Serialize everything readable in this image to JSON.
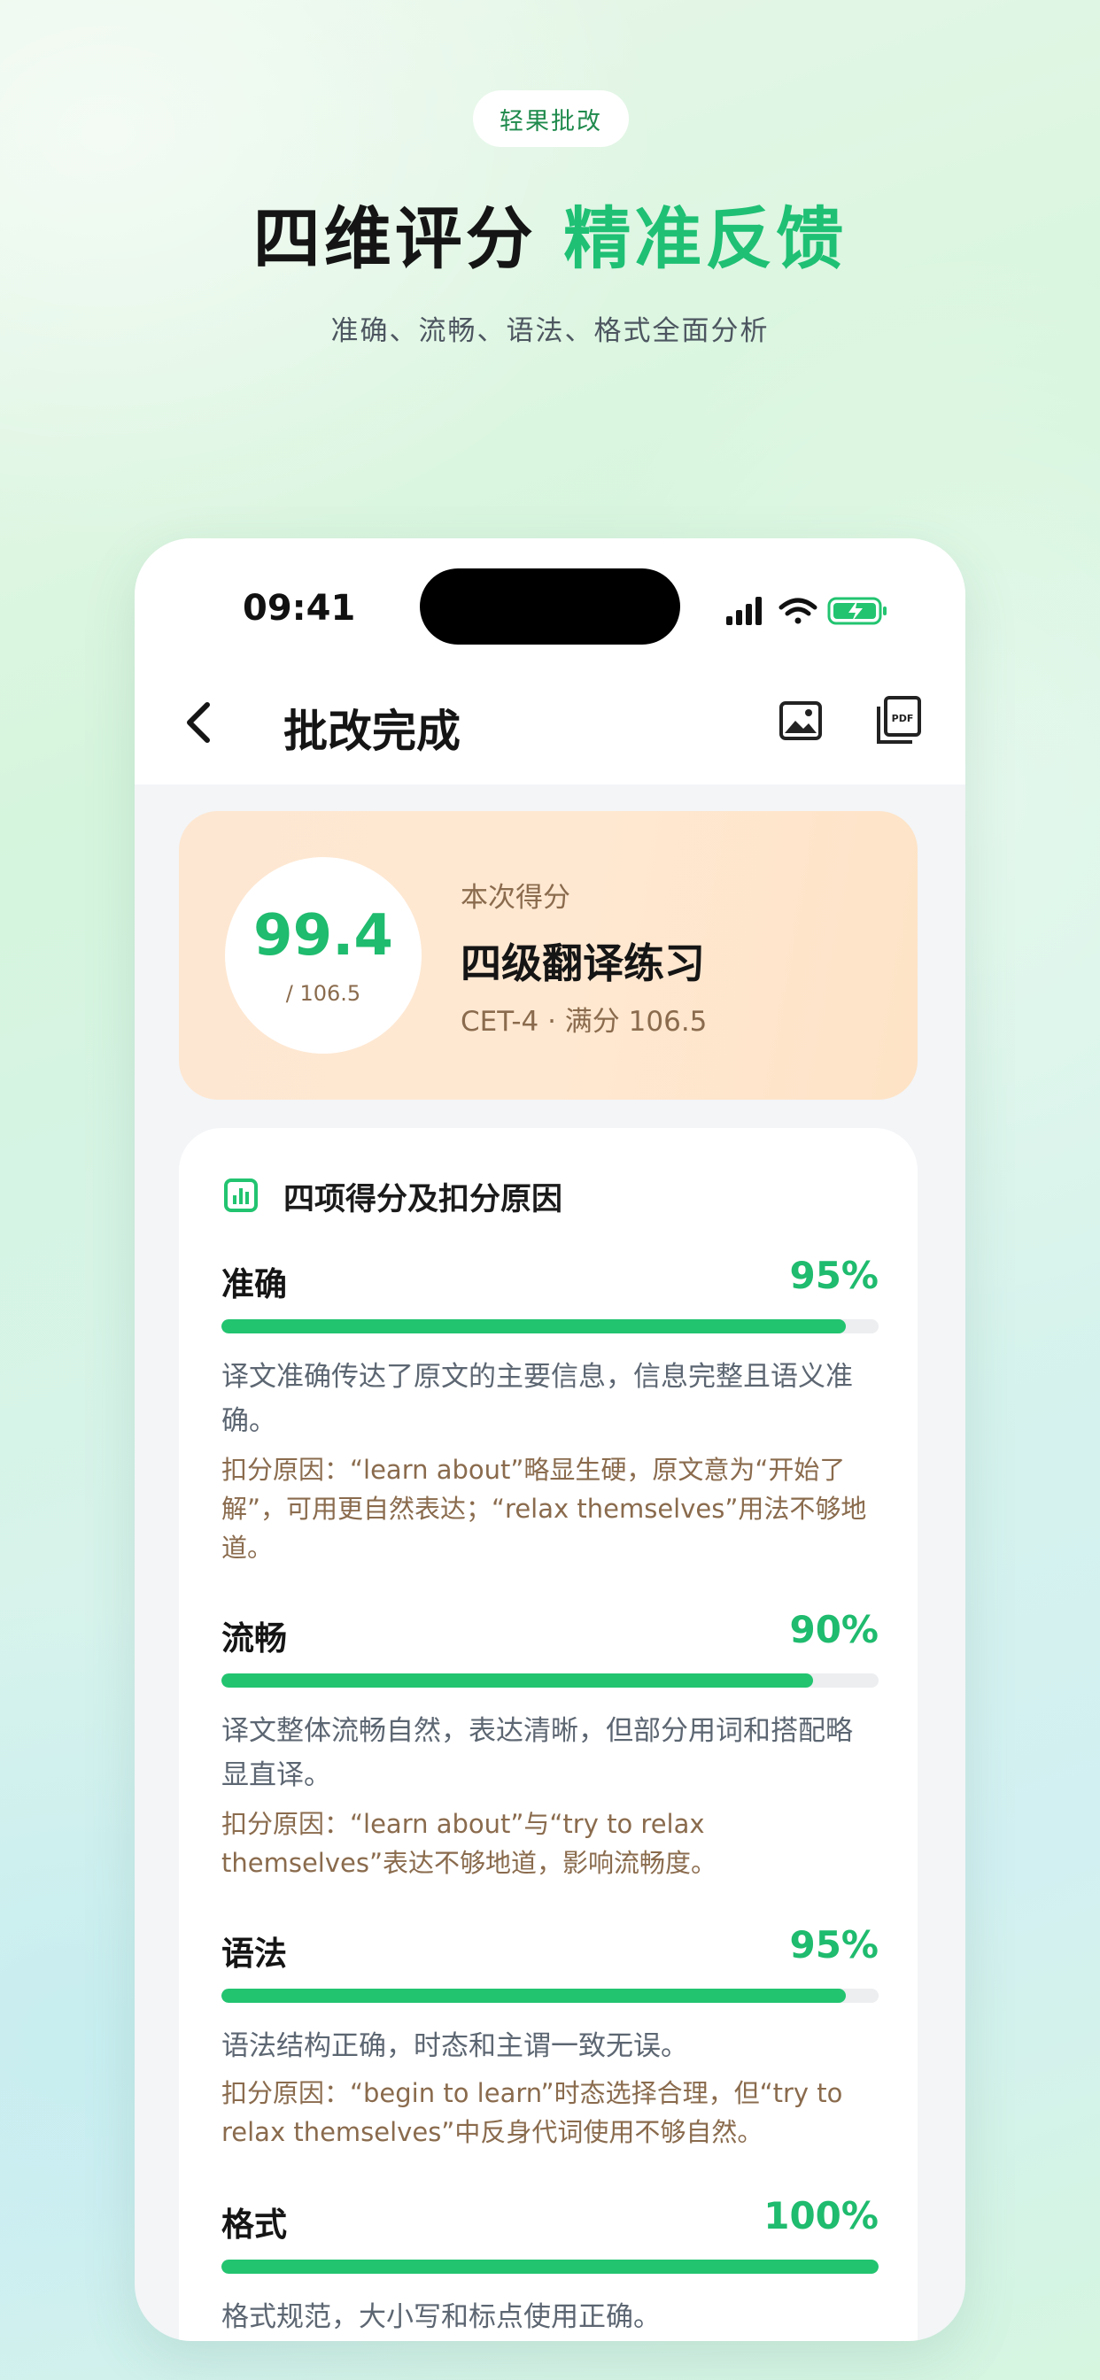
{
  "promo": {
    "badge": "轻果批改",
    "headline_main": "四维评分",
    "headline_accent": "精准反馈",
    "subline": "准确、流畅、语法、格式全面分析"
  },
  "status_bar": {
    "time": "09:41"
  },
  "nav": {
    "title": "批改完成",
    "image_icon": "image-icon",
    "pdf_icon": "pdf-icon"
  },
  "score_card": {
    "score": "99.4",
    "total": "/ 106.5",
    "label": "本次得分",
    "title": "四级翻译练习",
    "meta": "CET-4 · 满分 106.5"
  },
  "details": {
    "title": "四项得分及扣分原因",
    "metrics": [
      {
        "name": "准确",
        "percent_label": "95%",
        "percent": 95,
        "desc": "译文准确传达了原文的主要信息，信息完整且语义准确。",
        "reason": "扣分原因：“learn about”略显生硬，原文意为“开始了解”，可用更自然表达；“relax themselves”用法不够地道。"
      },
      {
        "name": "流畅",
        "percent_label": "90%",
        "percent": 90,
        "desc": "译文整体流畅自然，表达清晰，但部分用词和搭配略显直译。",
        "reason": "扣分原因：“learn about”与“try to relax themselves”表达不够地道，影响流畅度。"
      },
      {
        "name": "语法",
        "percent_label": "95%",
        "percent": 95,
        "desc": "语法结构正确，时态和主谓一致无误。",
        "reason": "扣分原因：“begin to learn”时态选择合理，但“try to relax themselves”中反身代词使用不够自然。"
      },
      {
        "name": "格式",
        "percent_label": "100%",
        "percent": 100,
        "desc": "格式规范，大小写和标点使用正确。"
      }
    ]
  },
  "colors": {
    "accent": "#1fbb6e",
    "bar": "#22c470",
    "reason": "#8a6b4d"
  }
}
